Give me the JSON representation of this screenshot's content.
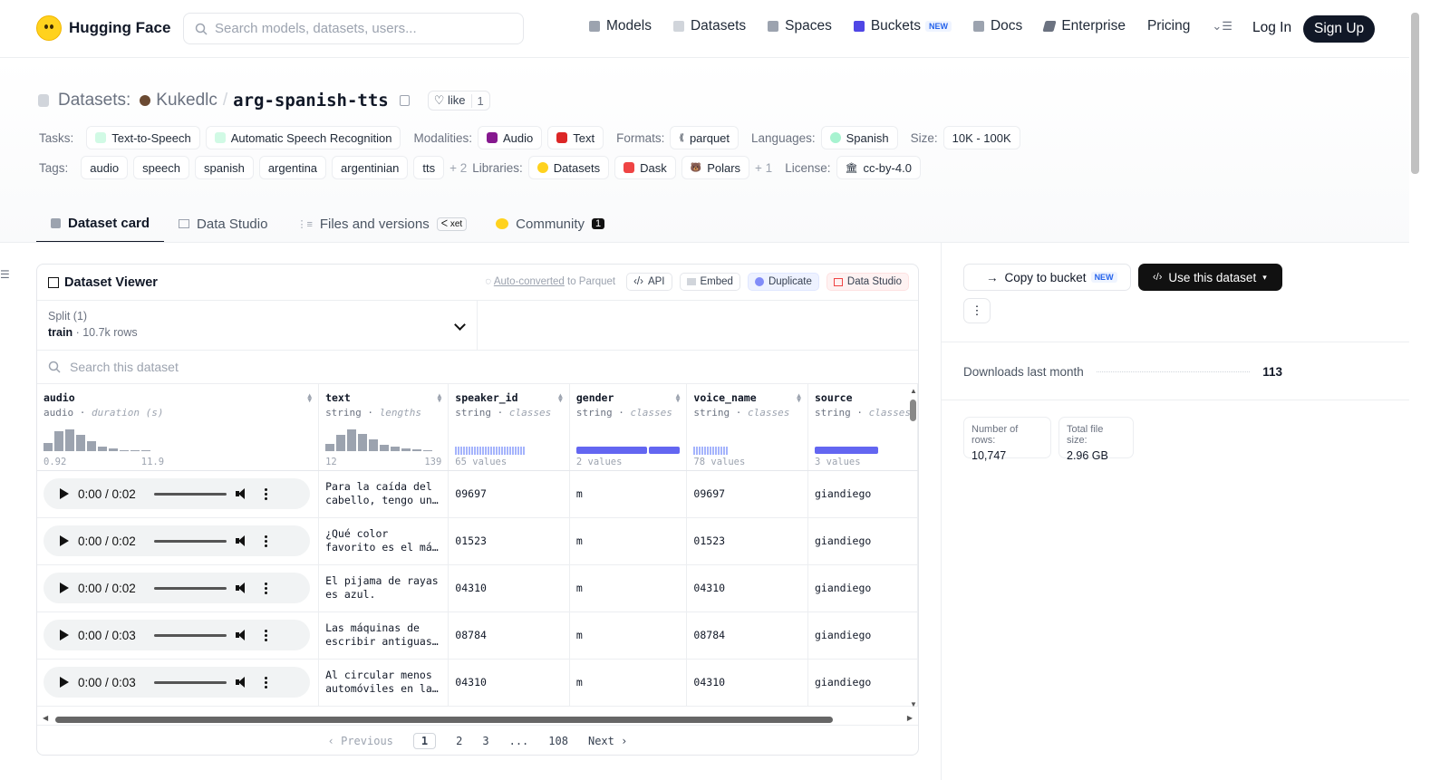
{
  "header": {
    "brand": "Hugging Face",
    "search_placeholder": "Search models, datasets, users...",
    "nav": [
      {
        "label": "Models",
        "color": "#9ca3af"
      },
      {
        "label": "Datasets",
        "color": "#d1d5db"
      },
      {
        "label": "Spaces",
        "color": "#9ca3af"
      },
      {
        "label": "Buckets",
        "color": "#4f46e5"
      },
      {
        "label": "Docs",
        "color": "#9ca3af"
      },
      {
        "label": "Enterprise",
        "color": "#6b7280"
      },
      {
        "label": "Pricing"
      }
    ],
    "new_badge": "NEW",
    "login": "Log In",
    "signup": "Sign Up"
  },
  "dataset": {
    "section": "Datasets:",
    "owner": "Kukedlc",
    "slash": "/",
    "name": "arg-spanish-tts",
    "like_label": "like",
    "like_count": "1"
  },
  "meta": {
    "tasks_label": "Tasks:",
    "tasks": [
      "Text-to-Speech",
      "Automatic Speech Recognition"
    ],
    "modalities_label": "Modalities:",
    "modalities": [
      "Audio",
      "Text"
    ],
    "formats_label": "Formats:",
    "format": "parquet",
    "languages_label": "Languages:",
    "language": "Spanish",
    "size_label": "Size:",
    "size": "10K - 100K",
    "tags_label": "Tags:",
    "tags": [
      "audio",
      "speech",
      "spanish",
      "argentina",
      "argentinian",
      "tts"
    ],
    "tags_more": "+ 2",
    "libraries_label": "Libraries:",
    "libraries": [
      "Datasets",
      "Dask",
      "Polars"
    ],
    "libraries_more": "+ 1",
    "license_label": "License:",
    "license": "cc-by-4.0"
  },
  "tabs": [
    {
      "label": "Dataset card",
      "active": true
    },
    {
      "label": "Data Studio"
    },
    {
      "label": "Files and versions",
      "badge": "xet"
    },
    {
      "label": "Community",
      "badge": "1"
    }
  ],
  "viewer": {
    "title": "Dataset Viewer",
    "auto_converted": "Auto-converted",
    "to_parquet": " to Parquet",
    "buttons": [
      "API",
      "Embed",
      "Duplicate",
      "Data Studio"
    ],
    "split_label": "Split (1)",
    "split_name": "train",
    "split_rows": "10.7k rows",
    "search_placeholder": "Search this dataset",
    "columns": [
      {
        "name": "audio",
        "type": "audio",
        "stat": "duration (s)",
        "min": "0.92",
        "max": "11.9"
      },
      {
        "name": "text",
        "type": "string",
        "stat": "lengths",
        "min": "12",
        "max": "139"
      },
      {
        "name": "speaker_id",
        "type": "string",
        "stat": "classes",
        "values": "65 values"
      },
      {
        "name": "gender",
        "type": "string",
        "stat": "classes",
        "values": "2 values"
      },
      {
        "name": "voice_name",
        "type": "string",
        "stat": "classes",
        "values": "78 values"
      },
      {
        "name": "source",
        "type": "string",
        "stat": "classes",
        "values": "3 values"
      }
    ],
    "rows": [
      {
        "time": "0:00 / 0:02",
        "text1": "Para la caída del",
        "text2": "cabello, tengo un…",
        "speaker_id": "09697",
        "gender": "m",
        "voice_name": "09697",
        "source": "giandiego"
      },
      {
        "time": "0:00 / 0:02",
        "text1": "¿Qué color",
        "text2": "favorito es el má…",
        "speaker_id": "01523",
        "gender": "m",
        "voice_name": "01523",
        "source": "giandiego"
      },
      {
        "time": "0:00 / 0:02",
        "text1": "El pijama de rayas",
        "text2": "es azul.",
        "speaker_id": "04310",
        "gender": "m",
        "voice_name": "04310",
        "source": "giandiego"
      },
      {
        "time": "0:00 / 0:03",
        "text1": "Las máquinas de",
        "text2": "escribir antiguas…",
        "speaker_id": "08784",
        "gender": "m",
        "voice_name": "08784",
        "source": "giandiego"
      },
      {
        "time": "0:00 / 0:03",
        "text1": "Al circular menos",
        "text2": "automóviles en la…",
        "speaker_id": "04310",
        "gender": "m",
        "voice_name": "04310",
        "source": "giandiego"
      }
    ],
    "pager": {
      "prev": "Previous",
      "pages": [
        "1",
        "2",
        "3",
        "...",
        "108"
      ],
      "next": "Next"
    }
  },
  "sidebar": {
    "copy_bucket": "Copy to bucket",
    "use_dataset": "Use this dataset",
    "downloads_label": "Downloads last month",
    "downloads": "113",
    "rows_label": "Number of rows:",
    "rows": "10,747",
    "size_label": "Total file size:",
    "size": "2.96 GB"
  }
}
